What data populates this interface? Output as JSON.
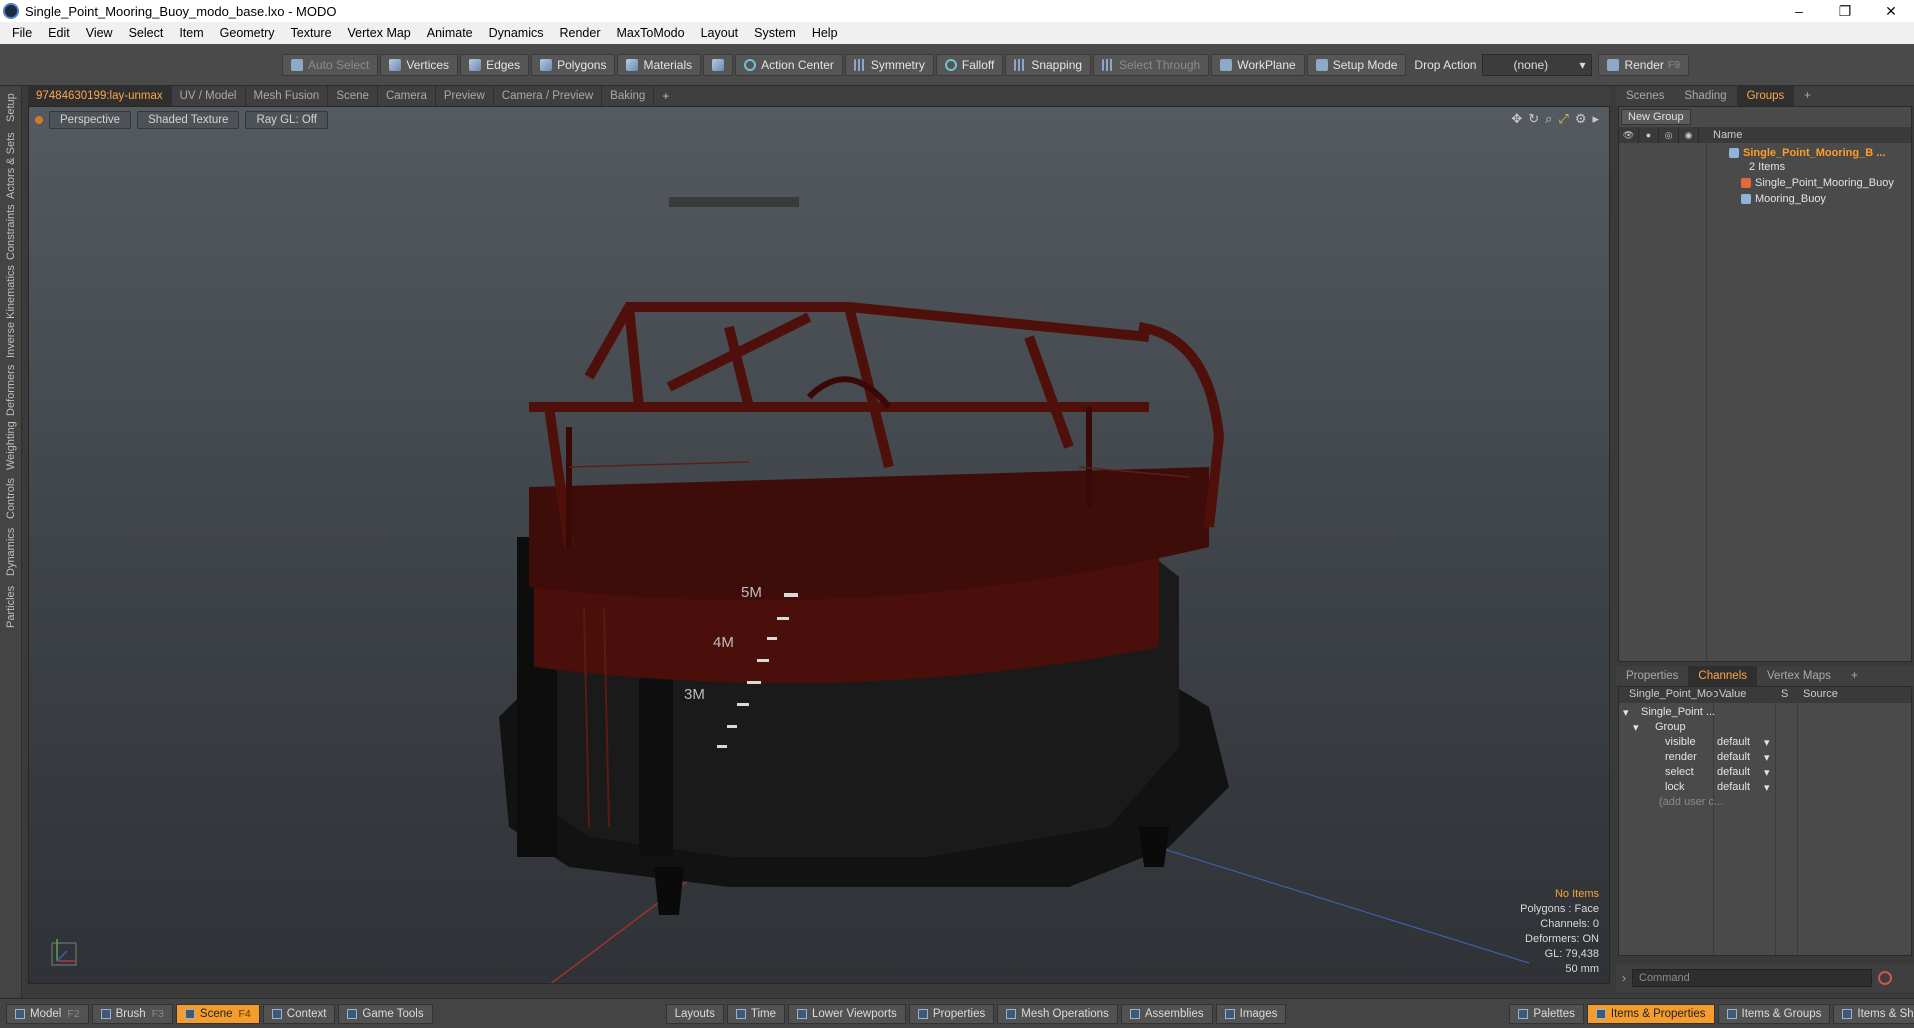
{
  "window": {
    "title": "Single_Point_Mooring_Buoy_modo_base.lxo - MODO",
    "minimize": "–",
    "restore": "❐",
    "close": "✕"
  },
  "menu": [
    "File",
    "Edit",
    "View",
    "Select",
    "Item",
    "Geometry",
    "Texture",
    "Vertex Map",
    "Animate",
    "Dynamics",
    "Render",
    "MaxToModo",
    "Layout",
    "System",
    "Help"
  ],
  "toolbar": {
    "auto_select": "Auto Select",
    "vertices": "Vertices",
    "edges": "Edges",
    "polygons": "Polygons",
    "materials": "Materials",
    "action_center": "Action Center",
    "symmetry": "Symmetry",
    "falloff": "Falloff",
    "snapping": "Snapping",
    "select_through": "Select Through",
    "workplane": "WorkPlane",
    "setup_mode": "Setup Mode",
    "drop_action": "Drop Action",
    "drop_value": "(none)",
    "render": "Render",
    "render_key": "F9"
  },
  "left_tabs": [
    "Setup",
    "Actors & Sets",
    "Constraints",
    "Inverse Kinematics",
    "Deformers",
    "Weighting",
    "Controls",
    "Dynamics",
    "Particles"
  ],
  "viewport_tabs": [
    "97484630199:lay-unmax",
    "UV / Model",
    "Mesh Fusion",
    "Scene",
    "Camera",
    "Preview",
    "Camera / Preview",
    "Baking"
  ],
  "viewport": {
    "perspective": "Perspective",
    "shading": "Shaded Texture",
    "raygl": "Ray GL: Off",
    "marks": [
      "5M",
      "4M",
      "3M"
    ],
    "stats": {
      "items": "No Items",
      "polygons": "Polygons : Face",
      "channels": "Channels: 0",
      "deformers": "Deformers: ON",
      "gl": "GL: 79,438",
      "focal": "50 mm"
    }
  },
  "right_tabs": [
    "Scenes",
    "Shading",
    "Groups"
  ],
  "groups": {
    "new_group": "New Group",
    "name_col": "Name",
    "group_name": "Single_Point_Mooring_B ...",
    "count": "2 Items",
    "items": [
      "Single_Point_Mooring_Buoy",
      "Mooring_Buoy"
    ]
  },
  "props_tabs": [
    "Properties",
    "Channels",
    "Vertex Maps"
  ],
  "channels": {
    "col_name": "Single_Point_Moo ...",
    "col_value": "Value",
    "col_s": "S",
    "col_source": "Source",
    "root": "Single_Point ...",
    "group": "Group",
    "rows": [
      {
        "name": "visible",
        "value": "default"
      },
      {
        "name": "render",
        "value": "default"
      },
      {
        "name": "select",
        "value": "default"
      },
      {
        "name": "lock",
        "value": "default"
      }
    ],
    "add_user": "(add user c..."
  },
  "command": {
    "placeholder": "Command"
  },
  "bottom": {
    "model": "Model",
    "model_key": "F2",
    "brush": "Brush",
    "brush_key": "F3",
    "scene": "Scene",
    "scene_key": "F4",
    "context": "Context",
    "game_tools": "Game Tools",
    "layouts": "Layouts",
    "time": "Time",
    "lower_viewports": "Lower Viewports",
    "properties": "Properties",
    "mesh_operations": "Mesh Operations",
    "assemblies": "Assemblies",
    "images": "Images",
    "palettes": "Palettes",
    "items_properties": "Items & Properties",
    "items_groups": "Items & Groups",
    "items_shading": "Items & Shading"
  }
}
